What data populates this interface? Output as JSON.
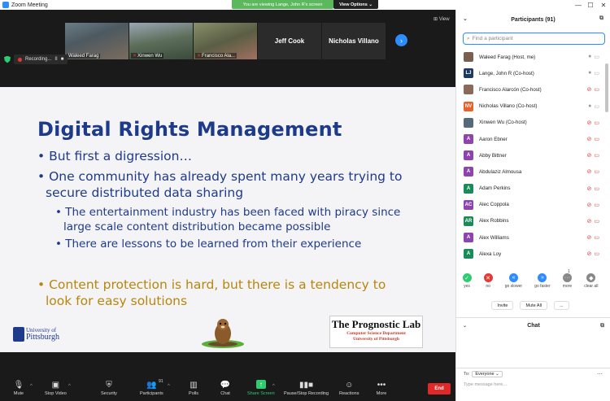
{
  "titlebar": {
    "title": "Zoom Meeting",
    "viewing_banner": "You are viewing Lange, John R's screen",
    "view_options": "View Options ⌄",
    "minimize": "—",
    "maximize": "☐",
    "close": "✕"
  },
  "thumbs": [
    {
      "name": "Waleed Farag",
      "muted": false
    },
    {
      "name": "Xinwen Wu",
      "muted": true
    },
    {
      "name": "Francisco Ala...",
      "muted": true
    },
    {
      "name": "Jeff Cook",
      "muted": false
    },
    {
      "name": "Nicholas Villano",
      "muted": false
    }
  ],
  "view_btn": "⊞ View",
  "recording": {
    "label": "Recording...",
    "pause": "II",
    "stop": "■"
  },
  "slide": {
    "title": "Digital Rights Management",
    "bullets": [
      "• But first a digression…",
      "• One community has already spent many years trying to",
      "  secure distributed data sharing",
      "• The entertainment industry has been faced with piracy since",
      "  large scale content distribution became possible",
      "• There are lessons to be learned from their experience",
      "• Content protection is hard, but there is a tendency to",
      "  look for easy solutions"
    ],
    "logo_line1": "University of",
    "logo_line2": "Pittsburgh",
    "prog_title": "The Prognostic Lab",
    "prog_sub1": "Computer Science Department",
    "prog_sub2": "University of Pittsburgh"
  },
  "toolbar": {
    "mute": "Mute",
    "stop_video": "Stop Video",
    "security": "Security",
    "participants": "Participants",
    "participant_count": "91",
    "polls": "Polls",
    "chat": "Chat",
    "share_screen": "Share Screen",
    "pause_rec": "Pause/Stop Recording",
    "reactions": "Reactions",
    "more": "More",
    "end": "End"
  },
  "panel": {
    "title": "Participants (91)",
    "search_placeholder": "Find a participant",
    "participants": [
      {
        "name": "Waleed Farag (Host, me)",
        "initials": "",
        "color": "#7a6050",
        "status": "host"
      },
      {
        "name": "Lange, John R (Co-host)",
        "initials": "LJ",
        "color": "#1f3a5f",
        "status": "sharing"
      },
      {
        "name": "Francisco Alarcón (Co-host)",
        "initials": "",
        "color": "#8a6a5a",
        "status": "muted"
      },
      {
        "name": "Nicholas Villano (Co-host)",
        "initials": "NV",
        "color": "#e8622c",
        "status": "unmuted"
      },
      {
        "name": "Xinwen Wu (Co-host)",
        "initials": "",
        "color": "#556b7a",
        "status": "muted"
      },
      {
        "name": "Aaron Ebner",
        "initials": "A",
        "color": "#8e44ad",
        "status": "muted"
      },
      {
        "name": "Abby Bittner",
        "initials": "A",
        "color": "#8e44ad",
        "status": "muted"
      },
      {
        "name": "Abdulaziz Almousa",
        "initials": "A",
        "color": "#8e44ad",
        "status": "muted"
      },
      {
        "name": "Adam Perkins",
        "initials": "A",
        "color": "#1b8a5a",
        "status": "muted"
      },
      {
        "name": "Alec Coppola",
        "initials": "AC",
        "color": "#8e44ad",
        "status": "muted"
      },
      {
        "name": "Alex Robbins",
        "initials": "AR",
        "color": "#1b8a5a",
        "status": "muted"
      },
      {
        "name": "Alex Williams",
        "initials": "A",
        "color": "#8e44ad",
        "status": "muted"
      },
      {
        "name": "Alexa Loy",
        "initials": "A",
        "color": "#1b8a5a",
        "status": "muted"
      }
    ],
    "reactions": [
      {
        "label": "yes",
        "glyph": "✓",
        "color": "#2ecc71"
      },
      {
        "label": "no",
        "glyph": "✕",
        "color": "#e53935"
      },
      {
        "label": "go slower",
        "glyph": "«",
        "color": "#2d8cff"
      },
      {
        "label": "go faster",
        "glyph": "»",
        "color": "#2d8cff"
      },
      {
        "label": "more",
        "glyph": "···",
        "color": "#888888"
      },
      {
        "label": "clear all",
        "glyph": "◆",
        "color": "#888888"
      }
    ],
    "reaction_more_count": "1",
    "invite": "Invite",
    "mute_all": "Mute All",
    "more_btn": "...",
    "chat_title": "Chat",
    "chat_to_label": "To:",
    "chat_to_value": "Everyone ⌄",
    "chat_placeholder": "Type message here..."
  }
}
